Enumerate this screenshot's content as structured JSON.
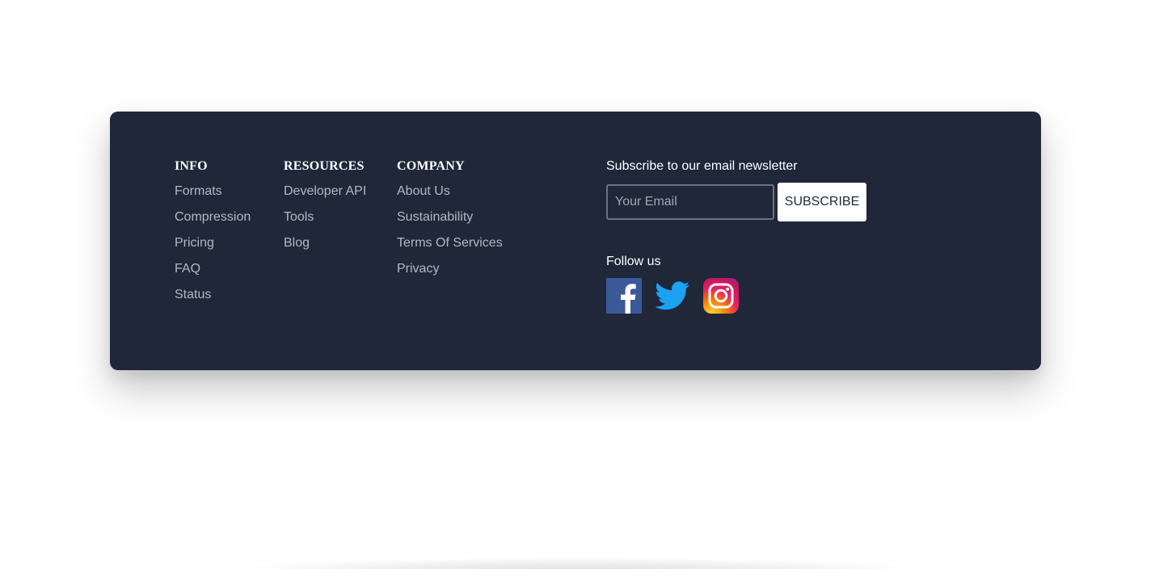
{
  "footer": {
    "columns": [
      {
        "heading": "INFO",
        "links": [
          "Formats",
          "Compression",
          "Pricing",
          "FAQ",
          "Status"
        ]
      },
      {
        "heading": "RESOURCES",
        "links": [
          "Developer API",
          "Tools",
          "Blog"
        ]
      },
      {
        "heading": "COMPANY",
        "links": [
          "About Us",
          "Sustainability",
          "Terms Of Services",
          "Privacy"
        ]
      }
    ],
    "newsletter": {
      "title": "Subscribe to our email newsletter",
      "email_placeholder": "Your Email",
      "email_value": "",
      "subscribe_label": "SUBSCRIBE"
    },
    "follow": {
      "title": "Follow us",
      "socials": [
        {
          "name": "facebook-icon",
          "color": "#3b5998"
        },
        {
          "name": "twitter-icon",
          "color": "#1da1f2"
        },
        {
          "name": "instagram-icon",
          "color": "#e1306c"
        }
      ]
    }
  },
  "colors": {
    "footer_background": "#1f2739",
    "link_text": "#b3b8c2",
    "heading_text": "#ffffff",
    "button_background": "#ffffff"
  }
}
